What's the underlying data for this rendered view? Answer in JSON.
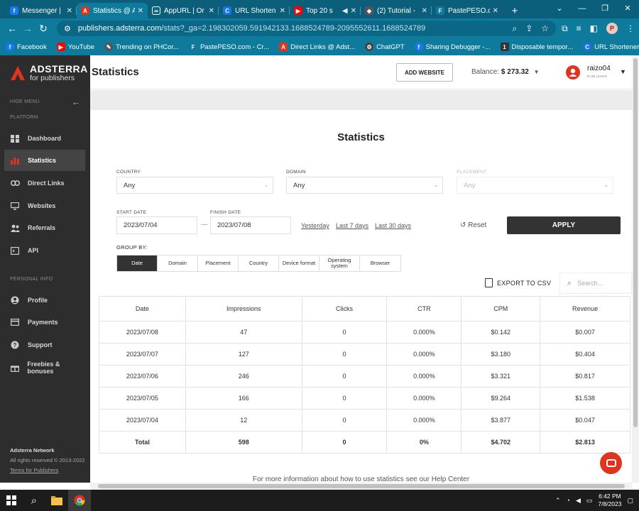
{
  "browser": {
    "tabs": [
      {
        "title": "Messenger |",
        "favicon": "f",
        "color": "#1877f2"
      },
      {
        "title": "Statistics @ A",
        "favicon": "A",
        "color": "#e0341e"
      },
      {
        "title": "AppURL | Or",
        "favicon": "∞",
        "color": "#0a6785"
      },
      {
        "title": "URL Shorten",
        "favicon": "C",
        "color": "#1a73e8"
      },
      {
        "title": "Top 20 s",
        "favicon": "▶",
        "color": "#ff0000"
      },
      {
        "title": "(2) Tutorial -",
        "favicon": "◆",
        "color": "#555"
      },
      {
        "title": "PastePESO.co",
        "favicon": "F",
        "color": "#0f7b9c"
      }
    ],
    "url_host": "publishers.adsterra.com",
    "url_path": "/stats?_ga=2.198302059.591942133.1688524789-2095552611.1688524789",
    "profile_initial": "P",
    "bookmarks": [
      {
        "label": "Facebook",
        "icon": "f",
        "color": "#1877f2"
      },
      {
        "label": "YouTube",
        "icon": "▶",
        "color": "#ff0000"
      },
      {
        "label": "Trending on PHCor...",
        "icon": "✎",
        "color": "#555"
      },
      {
        "label": "PastePESO.com - Cr...",
        "icon": "F",
        "color": "#0f7b9c"
      },
      {
        "label": "Direct Links @ Adst...",
        "icon": "A",
        "color": "#e0341e"
      },
      {
        "label": "ChatGPT",
        "icon": "⚙",
        "color": "#444"
      },
      {
        "label": "Sharing Debugger -...",
        "icon": "f",
        "color": "#1877f2"
      },
      {
        "label": "Disposable tempor...",
        "icon": "1",
        "color": "#333"
      },
      {
        "label": "URL Shortener, Cus...",
        "icon": "C",
        "color": "#1a73e8"
      }
    ]
  },
  "sidebar": {
    "brand": "ADSTERRA",
    "brand_sub": "for publishers",
    "hide_menu": "HIDE MENU",
    "section_platform": "PLATFORM",
    "section_personal": "PERSONAL INFO",
    "items": [
      {
        "label": "Dashboard",
        "icon": "dashboard-icon"
      },
      {
        "label": "Statistics",
        "icon": "statistics-icon"
      },
      {
        "label": "Direct Links",
        "icon": "link-icon"
      },
      {
        "label": "Websites",
        "icon": "monitor-icon"
      },
      {
        "label": "Referrals",
        "icon": "users-icon"
      },
      {
        "label": "API",
        "icon": "api-icon"
      },
      {
        "label": "Profile",
        "icon": "profile-icon"
      },
      {
        "label": "Payments",
        "icon": "payments-icon"
      },
      {
        "label": "Support",
        "icon": "support-icon"
      },
      {
        "label": "Freebies & bonuses",
        "icon": "gift-icon"
      }
    ],
    "footer_company": "Adsterra Network",
    "footer_rights": "All rights reserved © 2013-2022",
    "footer_terms": "Terms for Publishers"
  },
  "header": {
    "title": "Statistics",
    "add_website": "ADD WEBSITE",
    "balance_label": "Balance:",
    "balance_value": "$ 273.32",
    "username": "raizo04",
    "role": "PUBLISHER"
  },
  "filters": {
    "heading": "Statistics",
    "country_label": "COUNTRY",
    "country_value": "Any",
    "domain_label": "DOMAIN",
    "domain_value": "Any",
    "placement_label": "PLACEMENT",
    "placement_value": "Any",
    "start_label": "START DATE",
    "start_value": "2023/07/04",
    "finish_label": "FINISH DATE",
    "finish_value": "2023/07/08",
    "yesterday": "Yesterday",
    "last7": "Last 7 days",
    "last30": "Last 30 days",
    "reset": "Reset",
    "apply": "APPLY",
    "group_by_label": "GROUP BY:",
    "group_by": [
      "Date",
      "Domain",
      "Placement",
      "Country",
      "Device format",
      "Operating system",
      "Browser"
    ]
  },
  "table": {
    "export": "EXPORT TO CSV",
    "search_placeholder": "Search...",
    "columns": [
      "Date",
      "Impressions",
      "Clicks",
      "CTR",
      "CPM",
      "Revenue"
    ],
    "rows": [
      [
        "2023/07/08",
        "47",
        "0",
        "0.000%",
        "$0.142",
        "$0.007"
      ],
      [
        "2023/07/07",
        "127",
        "0",
        "0.000%",
        "$3.180",
        "$0.404"
      ],
      [
        "2023/07/06",
        "246",
        "0",
        "0.000%",
        "$3.321",
        "$0.817"
      ],
      [
        "2023/07/05",
        "166",
        "0",
        "0.000%",
        "$9.264",
        "$1.538"
      ],
      [
        "2023/07/04",
        "12",
        "0",
        "0.000%",
        "$3.877",
        "$0.047"
      ]
    ],
    "total": [
      "Total",
      "598",
      "0",
      "0%",
      "$4.702",
      "$2.813"
    ]
  },
  "footer_note": "For more information about how to use statistics see our Help Center",
  "taskbar": {
    "time": "6:42 PM",
    "date": "7/8/2023"
  }
}
